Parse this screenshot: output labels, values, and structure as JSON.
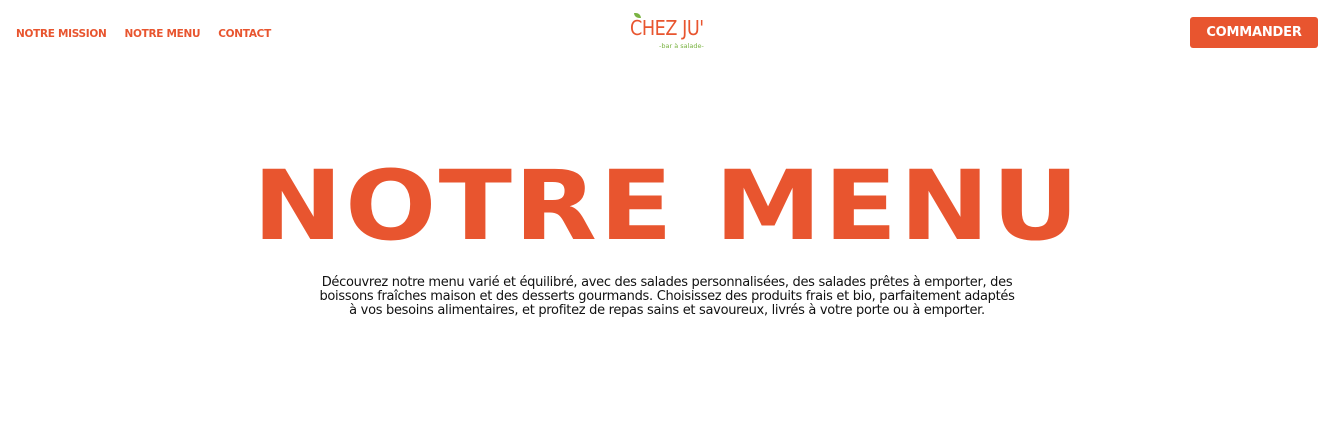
{
  "nav": {
    "items": [
      {
        "label": "NOTRE MISSION"
      },
      {
        "label": "NOTRE MENU"
      },
      {
        "label": "CONTACT"
      }
    ]
  },
  "logo": {
    "name": "CHEZ JU'",
    "tagline": "-bar à salade-"
  },
  "header": {
    "cta_label": "COMMANDER"
  },
  "hero": {
    "title": "NOTRE MENU",
    "description": "Découvrez notre menu varié et équilibré, avec des salades personnalisées, des salades prêtes à emporter, des boissons fraîches maison et des desserts gourmands. Choisissez des produits frais et bio, parfaitement adaptés à vos besoins alimentaires, et profitez de repas sains et savoureux, livrés à votre porte ou à emporter."
  },
  "colors": {
    "brand_orange": "#e8552f",
    "brand_green": "#7ab342",
    "background": "#ffffff",
    "text": "#111111"
  }
}
